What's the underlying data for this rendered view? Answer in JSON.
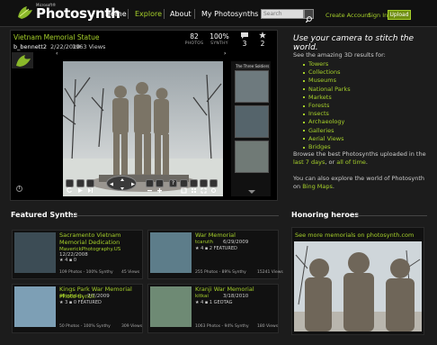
{
  "header": {
    "logo_small": "Microsoft®",
    "logo_text": "Photosynth",
    "nav": [
      "Home",
      "Explore",
      "About",
      "My Photosynths"
    ],
    "search_placeholder": "Search",
    "create_account": "Create Account",
    "sign_in": "Sign In",
    "upload": "Upload",
    "accent": "#a5cf2a"
  },
  "viewer": {
    "title": "Vietnam Memorial Statue",
    "user": "b_bennett2",
    "date": "2/22/2010",
    "views": "1963 Views",
    "stats": [
      {
        "num": "82",
        "label": "PHOTOS"
      },
      {
        "num": "100%",
        "label": "SYNTHY"
      },
      {
        "num": "3",
        "label": ""
      },
      {
        "num": "2",
        "label": ""
      }
    ],
    "thumb_caption": "The Three Soldiers"
  },
  "right": {
    "tagline": "Use your camera to stitch the world.",
    "intro": "See the amazing 3D results for:",
    "categories": [
      "Towers",
      "Collections",
      "Museums",
      "National Parks",
      "Markets",
      "Forests",
      "Insects",
      "Archaeology",
      "Galleries",
      "Aerial Views",
      "Bridges"
    ],
    "browse_a": "Browse the best Photosynths uploaded in the",
    "browse_link1": "last 7 days",
    "browse_b": ", or",
    "browse_link2": "all of time",
    "explore_a": "You can also explore the world of Photosynth on",
    "explore_link": "Bing Maps"
  },
  "featured": {
    "title": "Featured Synths",
    "cards": [
      {
        "title": "Sacramento Vietnam Memorial Dedication",
        "user": "MaverickPhotography.US",
        "date": "12/22/2008",
        "rating": "4",
        "comments": "0",
        "featured": "",
        "foot": "109 Photos - 100% Synthy",
        "views": "45 Views"
      },
      {
        "title": "War Memorial",
        "user": "tcaruth",
        "date": "6/29/2009",
        "rating": "4",
        "comments": "2",
        "featured": "FEATURED",
        "foot": "255 Photos - 89% Synthy",
        "views": "15241 Views"
      },
      {
        "title": "Kings Park War Memorial Photo Synth",
        "user": "elliottdan",
        "date": "7/7/2009",
        "rating": "3",
        "comments": "0",
        "featured": "FEATURED",
        "foot": "50 Photos - 100% Synthy",
        "views": "309 Views"
      },
      {
        "title": "Kranji War Memorial",
        "user": "kitkai",
        "date": "3/18/2010",
        "rating": "4",
        "comments": "1",
        "featured": "GEOTAG",
        "foot": "1063 Photos - 94% Synthy",
        "views": "180 Views"
      }
    ]
  },
  "heroes": {
    "title": "Honoring heroes",
    "link": "See more memorials on photosynth.com"
  }
}
